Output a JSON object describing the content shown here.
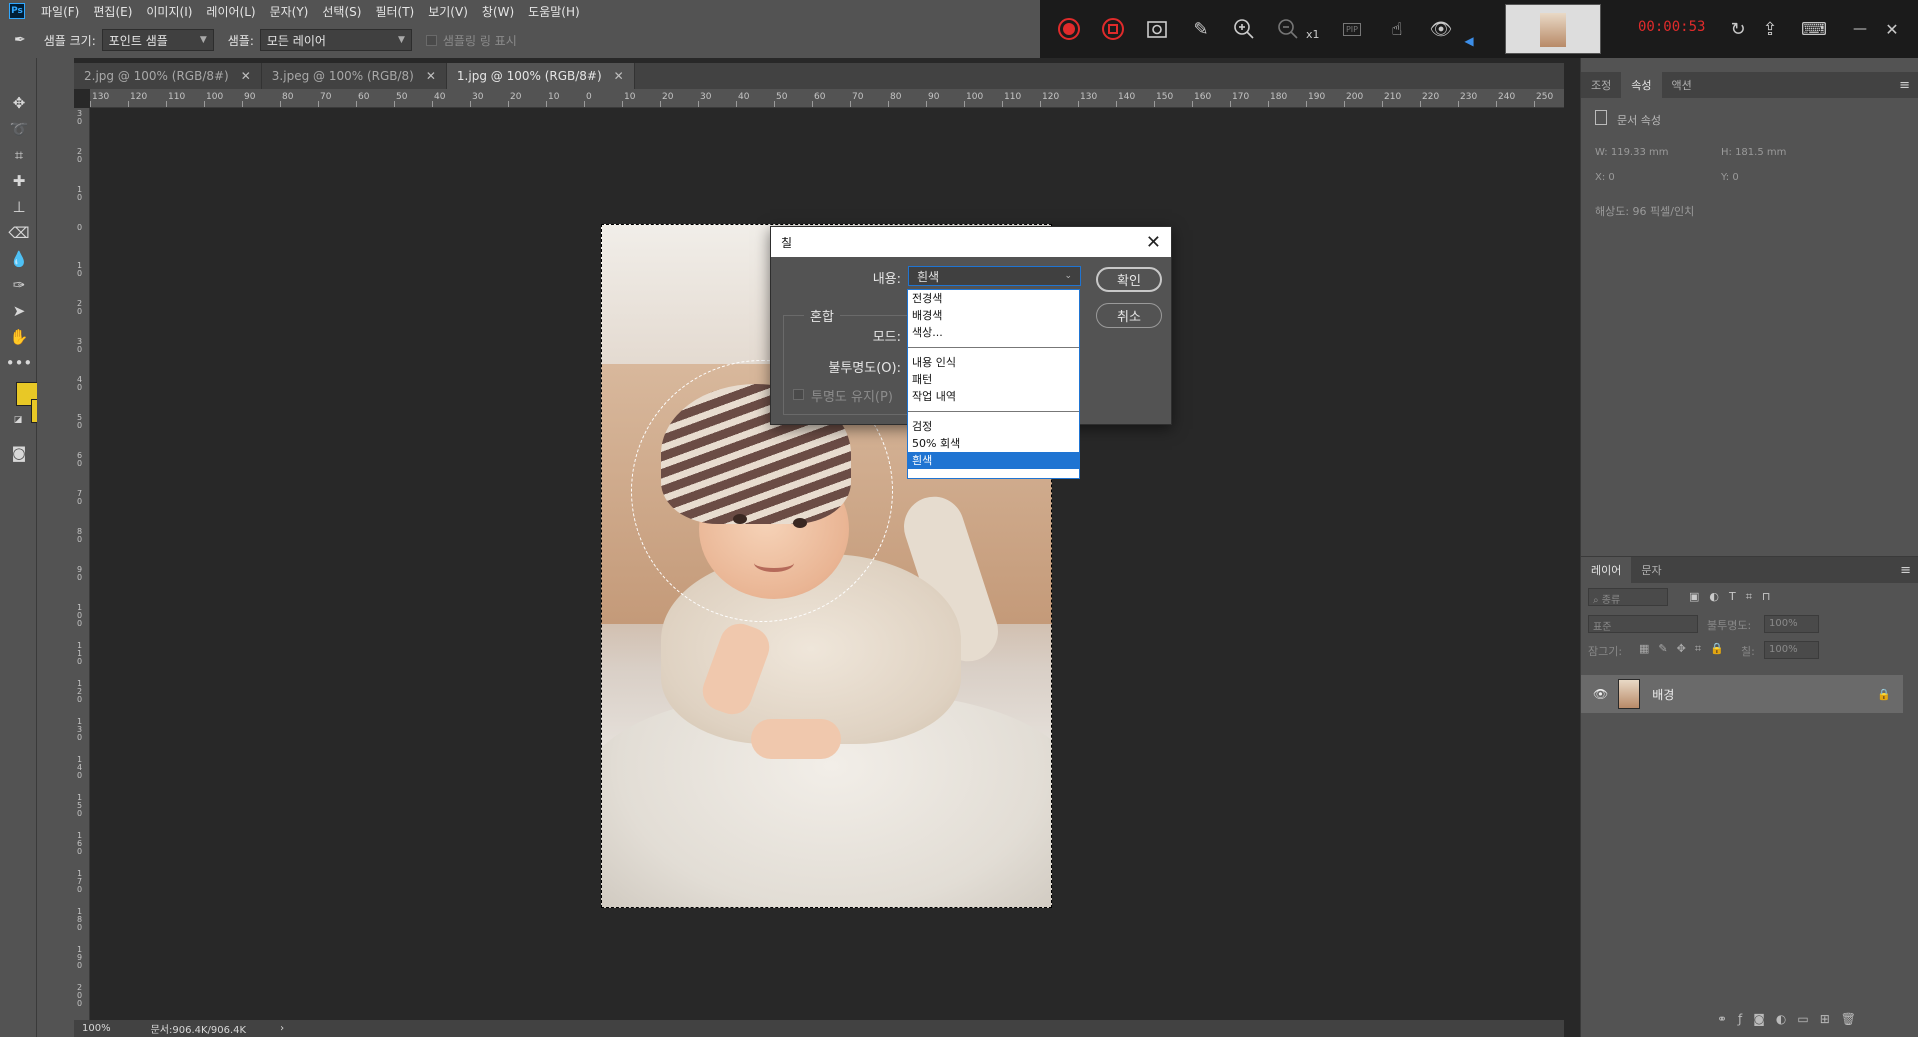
{
  "app": {
    "logo": "Ps"
  },
  "menu": [
    "파일(F)",
    "편집(E)",
    "이미지(I)",
    "레이어(L)",
    "문자(Y)",
    "선택(S)",
    "필터(T)",
    "보기(V)",
    "창(W)",
    "도움말(H)"
  ],
  "options": {
    "sample_size_label": "샘플 크기:",
    "sample_size_value": "포인트 샘플",
    "sample_label": "샘플:",
    "sample_value": "모든 레이어",
    "show_ring_label": "샘플링 링 표시"
  },
  "tabs": [
    {
      "label": "2.jpg @ 100% (RGB/8#)",
      "active": false
    },
    {
      "label": "3.jpeg @ 100% (RGB/8)",
      "active": false
    },
    {
      "label": "1.jpg @ 100% (RGB/8#)",
      "active": true
    }
  ],
  "recorder": {
    "time": "00:00:53",
    "zoom_level": "x1",
    "pip_label": "PIP"
  },
  "ruler_h": [
    "130",
    "120",
    "110",
    "100",
    "90",
    "80",
    "70",
    "60",
    "50",
    "40",
    "30",
    "20",
    "10",
    "0",
    "10",
    "20",
    "30",
    "40",
    "50",
    "60",
    "70",
    "80",
    "90",
    "100",
    "110",
    "120",
    "130",
    "140",
    "150",
    "160",
    "170",
    "180",
    "190",
    "200",
    "210",
    "220",
    "230",
    "240",
    "250"
  ],
  "ruler_v": [
    "3 0",
    "2 0",
    "1 0",
    "0",
    "1 0",
    "2 0",
    "3 0",
    "4 0",
    "5 0",
    "6 0",
    "7 0",
    "8 0",
    "9 0",
    "1 0 0",
    "1 1 0",
    "1 2 0",
    "1 3 0",
    "1 4 0",
    "1 5 0",
    "1 6 0",
    "1 7 0",
    "1 8 0",
    "1 9 0",
    "2 0 0"
  ],
  "dialog": {
    "title": "칠",
    "content_label": "내용:",
    "content_value": "흰색",
    "blend_title": "혼합",
    "mode_label": "모드:",
    "opacity_label": "불투명도(O):",
    "preserve_label": "투명도 유지(P)",
    "ok_label": "확인",
    "cancel_label": "취소"
  },
  "dropdown": {
    "group1": [
      "전경색",
      "배경색",
      "색상..."
    ],
    "group2": [
      "내용 인식",
      "패턴",
      "작업 내역"
    ],
    "group3": [
      "검정",
      "50% 회색",
      "흰색"
    ],
    "selected": "흰색"
  },
  "properties": {
    "tabs": [
      "조정",
      "속성",
      "액션"
    ],
    "active_tab": "속성",
    "doc_label": "문서 속성",
    "w": "W:  119.33 mm",
    "h": "H:  181.5 mm",
    "x": "X:  0",
    "y": "Y:  0",
    "resolution": "해상도: 96 픽셀/인치"
  },
  "layers": {
    "tabs": [
      "레이어",
      "문자"
    ],
    "active_tab": "레이어",
    "filter_label": "종류",
    "blend_mode": "표준",
    "opacity_label": "불투명도:",
    "opacity_value": "100%",
    "lock_label": "잠그기:",
    "fill_label": "칠:",
    "fill_value": "100%",
    "layer_name": "배경"
  },
  "status": {
    "zoom": "100%",
    "doc_size": "문서:906.4K/906.4K"
  },
  "colors": {
    "foreground": "#e8c826",
    "background": "#e8c826",
    "accent": "#1f74d2",
    "record": "#e02b2b"
  }
}
